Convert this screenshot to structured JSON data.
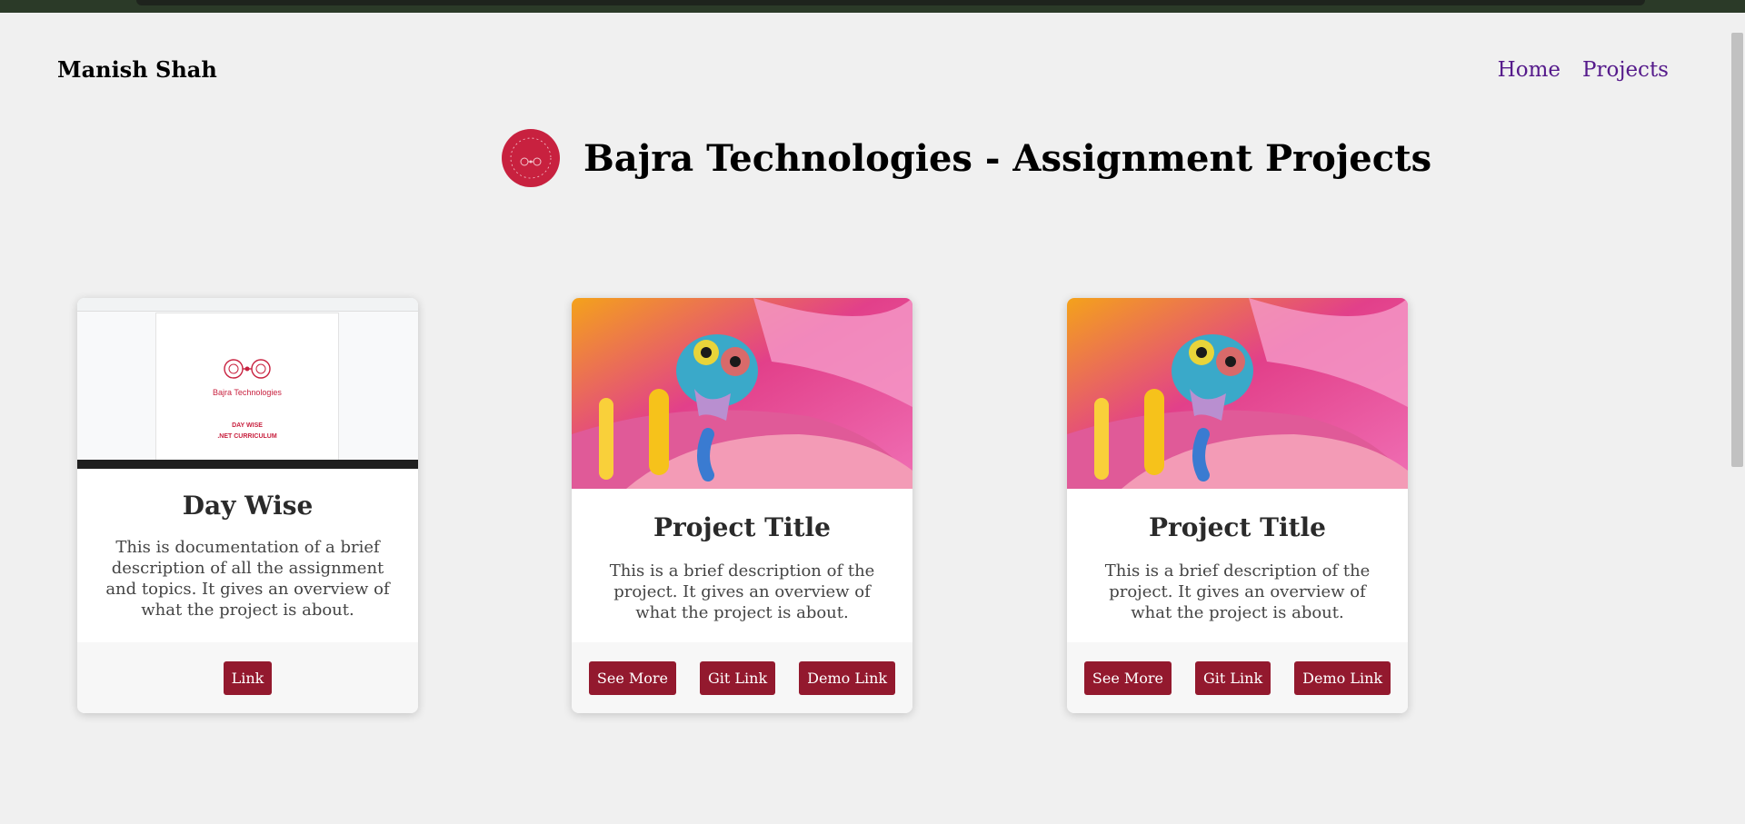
{
  "brand": "Manish Shah",
  "nav": {
    "home": "Home",
    "projects": "Projects"
  },
  "header": {
    "title": "Bajra Technologies - Assignment Projects"
  },
  "colors": {
    "accent": "#93192e",
    "logo": "#c8213f",
    "link": "#551a8b"
  },
  "cards": [
    {
      "title": "Day Wise",
      "description": "This is documentation of a brief description of all the assignment and topics. It gives an overview of what the project is about.",
      "thumbnail": {
        "brand": "Bajra Technologies",
        "line1": "DAY WISE",
        "line2": ".NET CURRICULUM"
      },
      "buttons": {
        "link": "Link"
      }
    },
    {
      "title": "Project Title",
      "description": "This is a brief description of the project. It gives an overview of what the project is about.",
      "buttons": {
        "see_more": "See More",
        "git": "Git Link",
        "demo": "Demo Link"
      }
    },
    {
      "title": "Project Title",
      "description": "This is a brief description of the project. It gives an overview of what the project is about.",
      "buttons": {
        "see_more": "See More",
        "git": "Git Link",
        "demo": "Demo Link"
      }
    }
  ]
}
